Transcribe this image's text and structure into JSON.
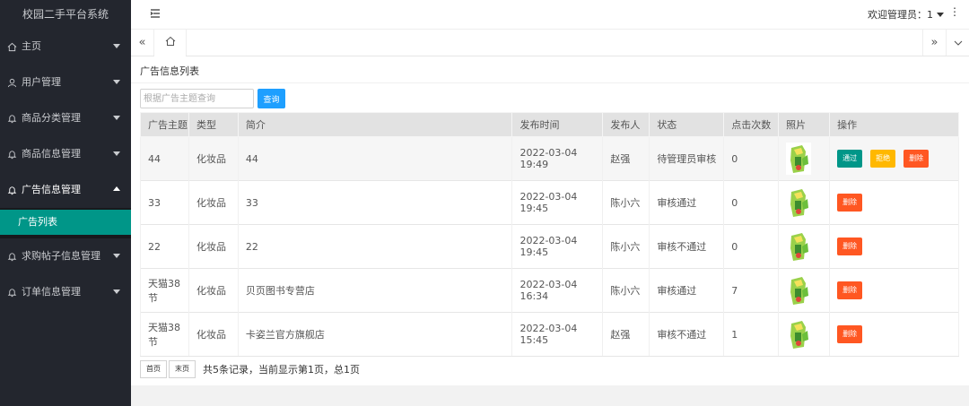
{
  "app": {
    "title": "校园二手平台系统"
  },
  "sidebar": {
    "items": [
      {
        "label": "主页",
        "icon": "home-icon"
      },
      {
        "label": "用户管理",
        "icon": "user-icon"
      },
      {
        "label": "商品分类管理",
        "icon": "bell-icon"
      },
      {
        "label": "商品信息管理",
        "icon": "bell-icon"
      },
      {
        "label": "广告信息管理",
        "icon": "bell-icon",
        "open": true
      },
      {
        "label": "求购帖子信息管理",
        "icon": "bell-icon"
      },
      {
        "label": "订单信息管理",
        "icon": "bell-icon"
      }
    ],
    "subitems": [
      {
        "label": "广告列表",
        "active": true
      }
    ]
  },
  "header": {
    "welcome": "欢迎管理员：1",
    "more": "⋮"
  },
  "tabs": {
    "left_arrow": "«",
    "right_arrow": "»"
  },
  "page": {
    "breadcrumb": "广告信息列表",
    "search": {
      "placeholder": "根据广告主题查询",
      "button": "查询"
    }
  },
  "table": {
    "headers": [
      "广告主题",
      "类型",
      "简介",
      "发布时间",
      "发布人",
      "状态",
      "点击次数",
      "照片",
      "操作"
    ],
    "rows": [
      {
        "topic": "44",
        "type": "化妆品",
        "intro": "44",
        "time": "2022-03-04 19:49",
        "publisher": "赵强",
        "status": "待管理员审核",
        "status_kind": "pending",
        "clicks": "0",
        "actions": [
          "通过",
          "拒绝",
          "删除"
        ]
      },
      {
        "topic": "33",
        "type": "化妆品",
        "intro": "33",
        "time": "2022-03-04 19:45",
        "publisher": "陈小六",
        "status": "审核通过",
        "status_kind": "ok",
        "clicks": "0",
        "actions": [
          "删除"
        ]
      },
      {
        "topic": "22",
        "type": "化妆品",
        "intro": "22",
        "time": "2022-03-04 19:45",
        "publisher": "陈小六",
        "status": "审核不通过",
        "status_kind": "bad",
        "clicks": "0",
        "actions": [
          "删除"
        ]
      },
      {
        "topic": "天猫38节",
        "type": "化妆品",
        "intro": "贝页图书专营店",
        "time": "2022-03-04 16:34",
        "publisher": "陈小六",
        "status": "审核通过",
        "status_kind": "ok",
        "clicks": "7",
        "actions": [
          "删除"
        ]
      },
      {
        "topic": "天猫38节",
        "type": "化妆品",
        "intro": "卡姿兰官方旗舰店",
        "time": "2022-03-04 15:45",
        "publisher": "赵强",
        "status": "审核不通过",
        "status_kind": "bad",
        "clicks": "1",
        "actions": [
          "删除"
        ]
      }
    ]
  },
  "pager": {
    "first": "首页",
    "last": "末页",
    "info": "共5条记录，当前显示第1页，总1页"
  },
  "colors": {
    "sidebar_bg": "#23262e",
    "accent": "#009688",
    "primary": "#1e9fff",
    "warn": "#ffb800",
    "danger": "#ff5722"
  }
}
